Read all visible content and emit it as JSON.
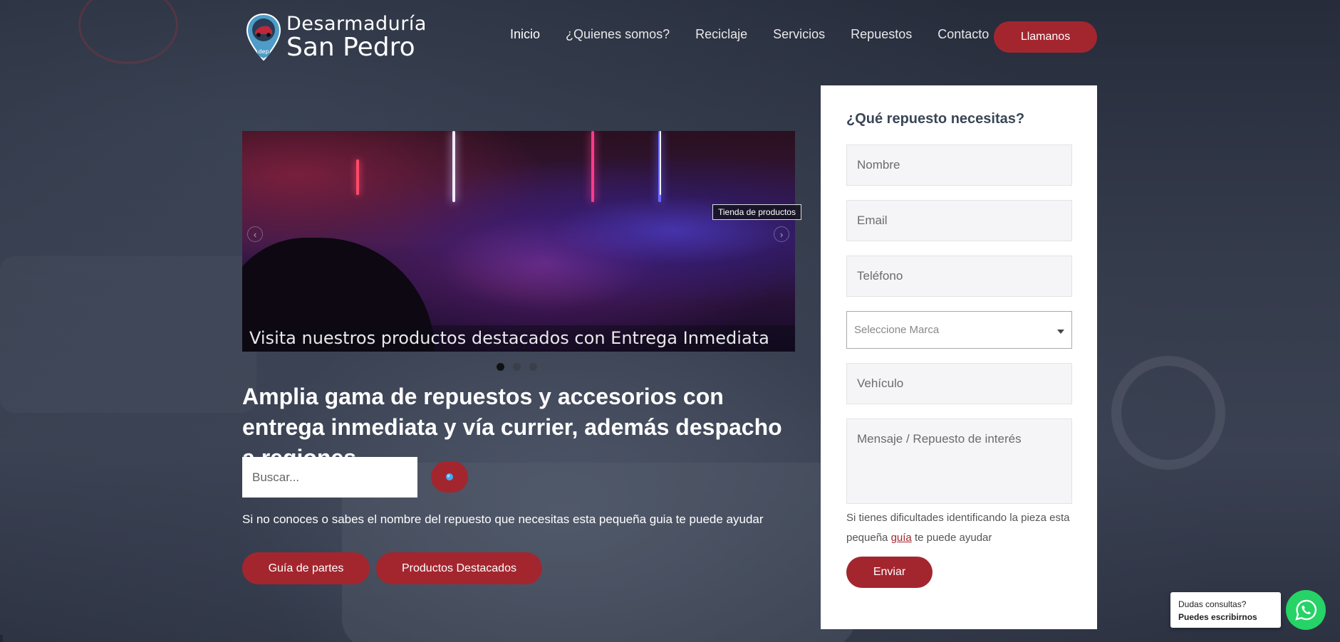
{
  "brand": {
    "line1": "Desarmaduría",
    "line2": "San Pedro",
    "badge": "dep"
  },
  "nav": {
    "items": [
      {
        "label": "Inicio",
        "active": true
      },
      {
        "label": "¿Quienes somos?"
      },
      {
        "label": "Reciclaje"
      },
      {
        "label": "Servicios"
      },
      {
        "label": "Repuestos"
      },
      {
        "label": "Contacto"
      }
    ],
    "call_label": "Llamanos"
  },
  "slider": {
    "tag": "Tienda de productos",
    "caption": "Visita nuestros productos destacados con Entrega Inmediata",
    "slides": 3,
    "active_slide": 1
  },
  "hero": {
    "headline": "Amplia gama de repuestos y accesorios con entrega inmediata y vía currier, además despacho a regiones",
    "search_placeholder": "Buscar...",
    "helper": "Si no conoces o sabes el nombre del repuesto que necesitas esta pequeña guia te puede ayudar",
    "btn_guide": "Guía de partes",
    "btn_featured": "Productos Destacados"
  },
  "form": {
    "title": "¿Qué repuesto necesitas?",
    "name_placeholder": "Nombre",
    "email_placeholder": "Email",
    "phone_placeholder": "Teléfono",
    "brand_select": "Seleccione Marca",
    "vehicle_placeholder": "Vehículo",
    "message_placeholder": "Mensaje / Repuesto de interés",
    "note_before": "Si tienes dificultades identificando la pieza esta pequeña ",
    "note_link": "guía",
    "note_after": " te puede ayudar",
    "submit": "Enviar"
  },
  "chat": {
    "line1": "Dudas consultas?",
    "line2": "Puedes escribirnos"
  },
  "colors": {
    "accent": "#a3262f",
    "whatsapp": "#25d366",
    "card": "#ffffff"
  }
}
